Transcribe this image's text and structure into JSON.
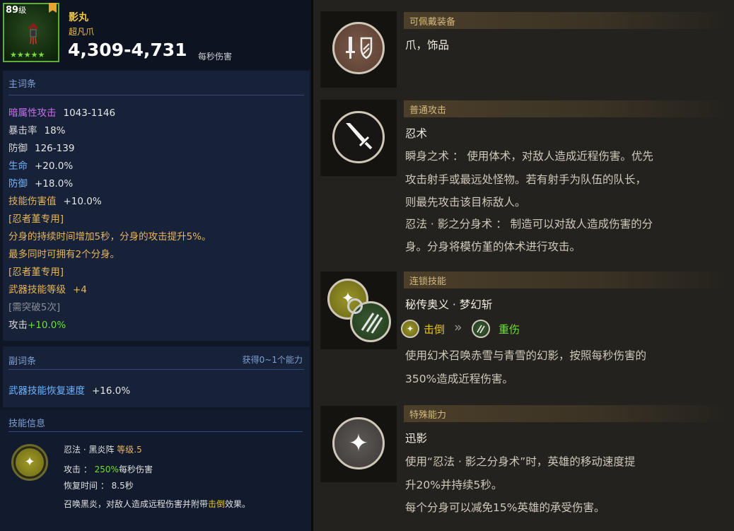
{
  "item": {
    "level": "89",
    "level_unit": "级",
    "stars": "★★★★★",
    "name": "影丸",
    "type": "超凡爪",
    "dps": "4,309-4,731",
    "dps_label": "每秒伤害"
  },
  "main_stats": {
    "title": "主词条",
    "rows": [
      {
        "key": "暗属性攻击",
        "value": "1043-1146"
      },
      {
        "key": "暴击率",
        "value": "18%"
      },
      {
        "key": "防御",
        "value": "126-139"
      },
      {
        "key": "生命",
        "value": "+20.0%"
      },
      {
        "key": "防御",
        "value": "+18.0%"
      },
      {
        "key": "技能伤害值",
        "value": "+10.0%"
      }
    ],
    "ninja_tag_1": "[忍者堇专用]",
    "ninja_line_1": "分身的持续时间增加5秒，分身的攻击提升5%。",
    "ninja_line_2": "最多同时可拥有2个分身。",
    "ninja_tag_2": "[忍者堇专用]",
    "weapon_skill_key": "武器技能等级",
    "weapon_skill_value": "+4",
    "breakthrough": "[需突破5次]",
    "attack_key": "攻击",
    "attack_value": "+10.0%"
  },
  "sub_stats": {
    "title": "副词条",
    "right_note": "获得0~1个能力",
    "key": "武器技能恢复速度",
    "value": "+16.0%"
  },
  "skill_info": {
    "title": "技能信息",
    "name": "忍法 · 黑炎阵",
    "level": "等级.5",
    "attack_label": "攻击 ：",
    "attack_pct": "250%",
    "attack_unit": "每秒伤害",
    "cooldown_label": "恢复时间 ：",
    "cooldown_value": "8.5秒",
    "desc_pre": "召唤黑炎，对敌人造成远程伤害并附带",
    "desc_hl": "击倒",
    "desc_post": "效果。"
  },
  "equip": {
    "category": "可佩戴装备",
    "value": "爪，饰品"
  },
  "normal_attack": {
    "category": "普通攻击",
    "title": "忍术",
    "lines": [
      "瞬身之术 ： 使用体术，对敌人造成近程伤害。优先",
      "攻击射手或最远处怪物。若有射手为队伍的队长，",
      "则最先攻击该目标敌人。",
      "忍法 · 影之分身术 ： 制造可以对敌人造成伤害的分",
      "身。分身将模仿堇的体术进行攻击。"
    ]
  },
  "chain_skill": {
    "category": "连锁技能",
    "title": "秘传奥义 · 梦幻斩",
    "from": "击倒",
    "arrow": "»",
    "to": "重伤",
    "lines": [
      "使用幻术召唤赤雪与青雪的幻影，按照每秒伤害的",
      "350%造成近程伤害。"
    ]
  },
  "special": {
    "category": "特殊能力",
    "title": "迅影",
    "lines": [
      "使用“忍法 · 影之分身术”时，英雄的移动速度提",
      "升20%并持续5秒。",
      "每个分身可以减免15%英雄的承受伤害。"
    ]
  },
  "colors": {
    "item_name": "#f3c64a",
    "dps_value": "#ffffff",
    "dark_attr": "#c96ef0",
    "hp_def": "#6fb3ff",
    "skill_gold": "#e8b65a",
    "green_value": "#6fe033",
    "category_text": "#d4b97e"
  },
  "icons": [
    "weapon-portrait",
    "sword-shield-icon",
    "dagger-icon",
    "chain-link-icon",
    "sparkle-icon",
    "claw-slash-icon"
  ]
}
